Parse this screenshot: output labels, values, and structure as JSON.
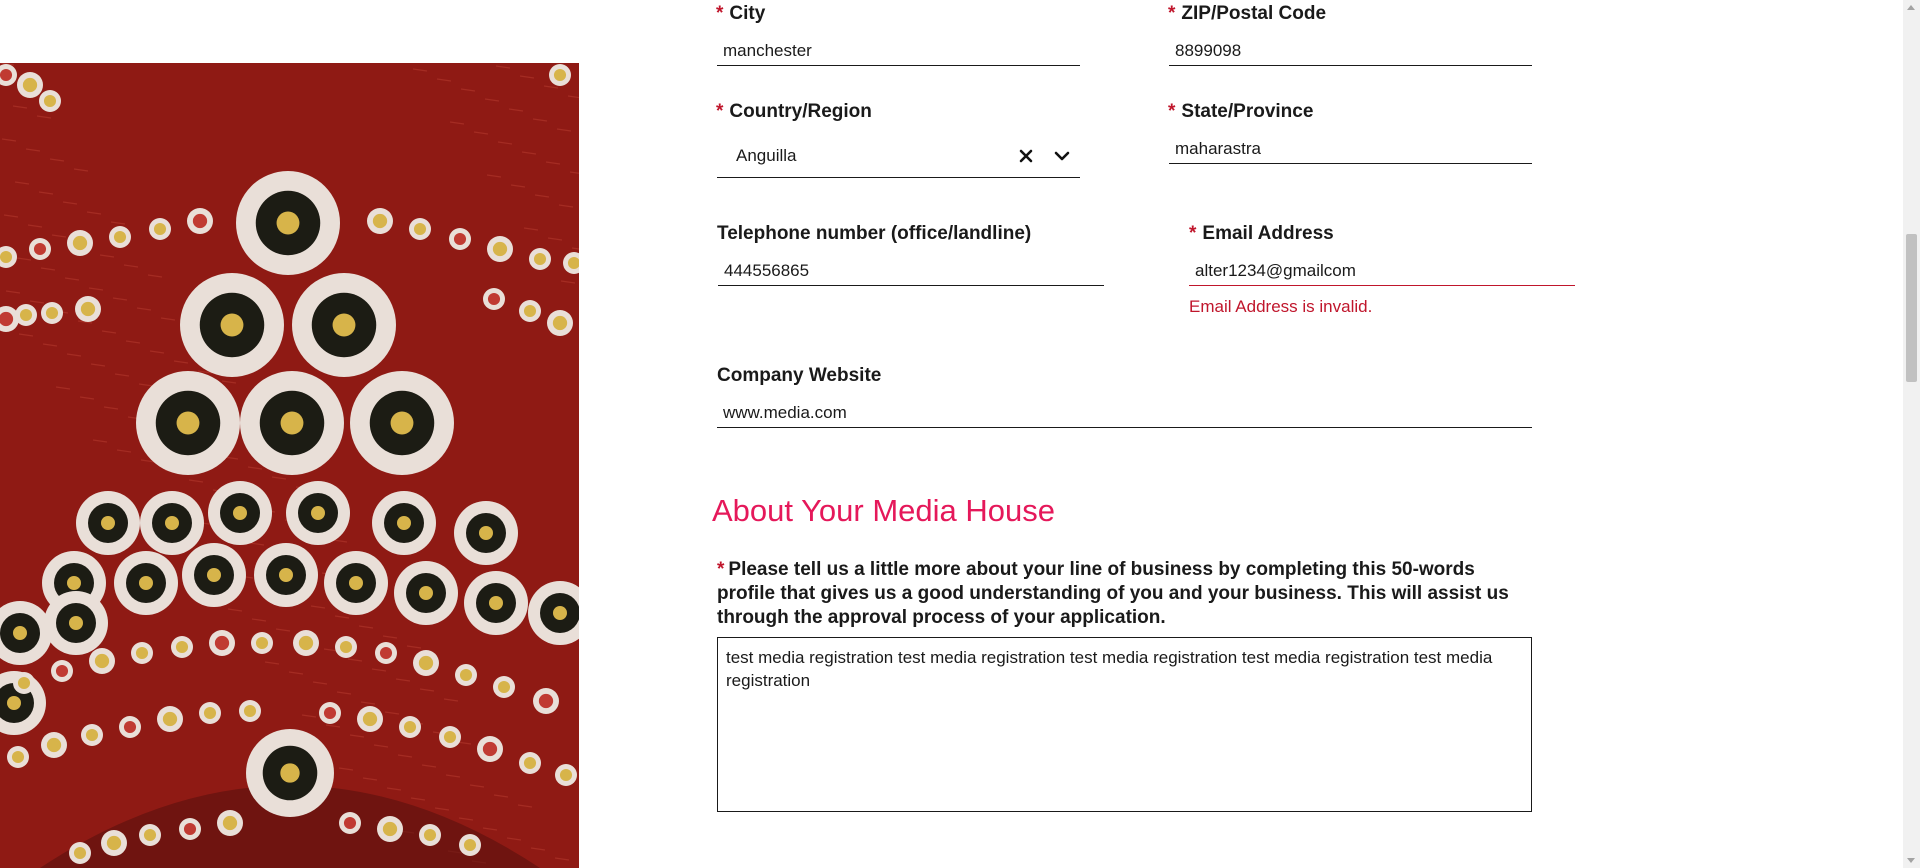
{
  "form": {
    "required_marker": "*",
    "city": {
      "label": "City",
      "value": "manchester"
    },
    "zip": {
      "label": "ZIP/Postal Code",
      "value": "8899098"
    },
    "country": {
      "label": "Country/Region",
      "value": "Anguilla"
    },
    "state": {
      "label": "State/Province",
      "value": "maharastra"
    },
    "telephone": {
      "label": "Telephone number (office/landline)",
      "value": "444556865"
    },
    "email": {
      "label": "Email Address",
      "value": "alter1234@gmailcom",
      "error": "Email Address is invalid."
    },
    "website": {
      "label": "Company Website",
      "value": "www.media.com"
    }
  },
  "about": {
    "title": "About Your Media House",
    "question": "Please tell us a little more about your line of business by completing this 50-words profile that gives us a good understanding of you and your business. This will assist us through the approval process of your application.",
    "answer": "test media registration test media registration test media registration test media registration test media registration"
  },
  "colors": {
    "required": "#c0162c",
    "error": "#c0162c",
    "section_title": "#e5185a",
    "art_background": "#8f1a14"
  },
  "icons": {
    "clear": "close-icon",
    "dropdown": "chevron-down-icon"
  }
}
